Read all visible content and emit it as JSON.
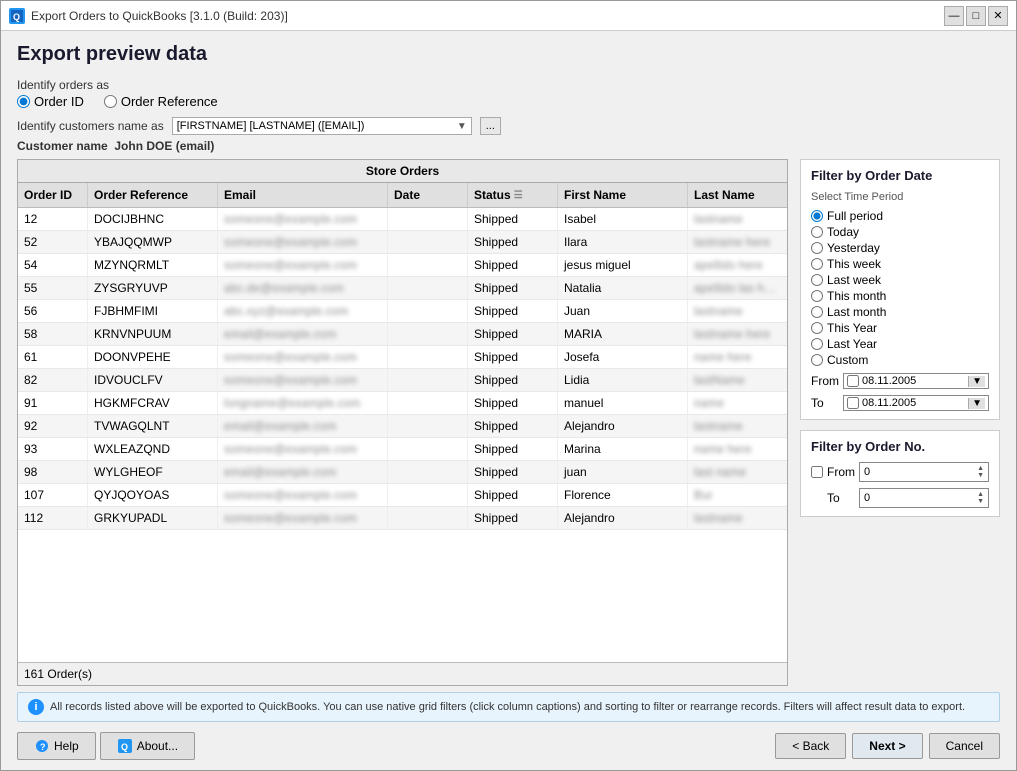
{
  "window": {
    "title": "Export Orders to QuickBooks [3.1.0 (Build: 203)]",
    "close_btn": "✕",
    "restore_btn": "□",
    "minimize_btn": "—"
  },
  "page": {
    "title": "Export preview data"
  },
  "identify": {
    "label": "Identify orders as",
    "order_id_label": "Order ID",
    "order_ref_label": "Order Reference"
  },
  "customer_name": {
    "label": "Identify customers name as",
    "format_value": "[FIRSTNAME] [LASTNAME] ([EMAIL])",
    "customer_label": "Customer name",
    "customer_value": "John DOE (email)"
  },
  "table": {
    "store_orders_label": "Store Orders",
    "columns": [
      "Order ID",
      "Order Reference",
      "Email",
      "Date",
      "Status",
      "First Name",
      "Last Name"
    ],
    "rows": [
      {
        "order_id": "12",
        "order_ref": "DOCIJBHNC",
        "email": "••••••••@••••••••••.com",
        "date": "",
        "status": "Shipped",
        "first_name": "Isabel",
        "last_name": "••••••••"
      },
      {
        "order_id": "52",
        "order_ref": "YBAJQQMWP",
        "email": "••••••••@••••••••.com",
        "date": "",
        "status": "Shipped",
        "first_name": "Ilara",
        "last_name": "••••••• •••••••"
      },
      {
        "order_id": "54",
        "order_ref": "MZYNQRMLT",
        "email": "••••••••@••••••••.com",
        "date": "",
        "status": "Shipped",
        "first_name": "jesus miguel",
        "last_name": "••••••• ••••"
      },
      {
        "order_id": "55",
        "order_ref": "ZYSGRYUVP",
        "email": "•••.••.••••@•••••••••.com",
        "date": "",
        "status": "Shipped",
        "first_name": "Natalia",
        "last_name": "•••••• ••• ••••••"
      },
      {
        "order_id": "56",
        "order_ref": "FJBHMFIMI",
        "email": "••••.•••@•••••••.com",
        "date": "",
        "status": "Shipped",
        "first_name": "Juan",
        "last_name": "••••••••"
      },
      {
        "order_id": "58",
        "order_ref": "KRNVNPUUM",
        "email": "•••••••@•••••••.com",
        "date": "",
        "status": "Shipped",
        "first_name": "MARIA",
        "last_name": "•••••••••• ••••"
      },
      {
        "order_id": "61",
        "order_ref": "DOONVPEHE",
        "email": "•••••••••@••••••••••.com",
        "date": "",
        "status": "Shipped",
        "first_name": "Josefa",
        "last_name": "•••• ••••••"
      },
      {
        "order_id": "82",
        "order_ref": "IDVOUCLFV",
        "email": "•••••••••@••••••••••.com",
        "date": "",
        "status": "Shipped",
        "first_name": "Lidia",
        "last_name": "•••••••"
      },
      {
        "order_id": "91",
        "order_ref": "HGKMFCRAV",
        "email": "•••••••••••••••••@•••••••.com",
        "date": "",
        "status": "Shipped",
        "first_name": "manuel",
        "last_name": "••••"
      },
      {
        "order_id": "92",
        "order_ref": "TVWAGQLNT",
        "email": "••••••@•••••••••.com",
        "date": "",
        "status": "Shipped",
        "first_name": "Alejandro",
        "last_name": "•••••••"
      },
      {
        "order_id": "93",
        "order_ref": "WXLEAZQND",
        "email": "•••••••••••••@•••••••.com",
        "date": "",
        "status": "Shipped",
        "first_name": "Marina",
        "last_name": "•••• ••••••"
      },
      {
        "order_id": "98",
        "order_ref": "WYLGHEOF",
        "email": "•••••••@•••••••.com",
        "date": "",
        "status": "Shipped",
        "first_name": "juan",
        "last_name": "•••••• •••••••"
      },
      {
        "order_id": "107",
        "order_ref": "QYJQOYOAS",
        "email": "••••••••••@••••••••••.com",
        "date": "",
        "status": "Shipped",
        "first_name": "Florence",
        "last_name": "•••"
      },
      {
        "order_id": "112",
        "order_ref": "GRKYUPADL",
        "email": "•••••••••@••••••••••.com",
        "date": "",
        "status": "Shipped",
        "first_name": "Alejandro",
        "last_name": "•••••••"
      }
    ],
    "footer": "161 Order(s)"
  },
  "filter_date": {
    "title": "Filter by Order Date",
    "subtitle": "Select Time Period",
    "options": [
      {
        "label": "Full period",
        "checked": true
      },
      {
        "label": "Today",
        "checked": false
      },
      {
        "label": "Yesterday",
        "checked": false
      },
      {
        "label": "This week",
        "checked": false
      },
      {
        "label": "Last week",
        "checked": false
      },
      {
        "label": "This month",
        "checked": false
      },
      {
        "label": "Last month",
        "checked": false
      },
      {
        "label": "This Year",
        "checked": false
      },
      {
        "label": "Last Year",
        "checked": false
      },
      {
        "label": "Custom",
        "checked": false
      }
    ],
    "from_label": "From",
    "to_label": "To",
    "from_value": "08.11.2005",
    "to_value": "08.11.2005"
  },
  "filter_no": {
    "title": "Filter by Order No.",
    "from_label": "From",
    "to_label": "To",
    "from_value": "0",
    "to_value": "0"
  },
  "info_bar": {
    "text": "All records listed above will be exported to QuickBooks. You can use native grid filters (click column captions) and sorting to filter or rearrange records. Filters will affect result data to export."
  },
  "bottom": {
    "help_label": "Help",
    "about_label": "About...",
    "back_label": "< Back",
    "next_label": "Next >",
    "cancel_label": "Cancel"
  }
}
